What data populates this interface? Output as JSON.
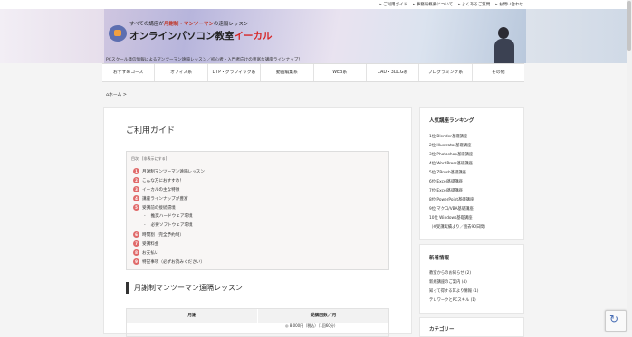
{
  "top_links": [
    "ご利用ガイド",
    "事務局概要について",
    "よくあるご質問",
    "お問い合わせ"
  ],
  "banner": {
    "tagline_pre": "すべての講座が",
    "tagline_highlight": "月謝制・マンツーマン",
    "tagline_post": "の遠隔レッスン",
    "brand_pre": "オンラインパソコン教室",
    "brand_accent": "イーカル",
    "subline": "PCスクール発信情報によるマンツーマン遠隔レッスン／初心者・入門者向けの豊富な講座ラインナップ！"
  },
  "nav": [
    "おすすめコース",
    "オフィス系",
    "DTP・グラフィック系",
    "動画編集系",
    "WEB系",
    "CAD・3DCG系",
    "プログラミング系",
    "その他"
  ],
  "breadcrumb": "ホーム",
  "page_title": "ご利用ガイド",
  "toc": {
    "header": "目次　[非表示にする]",
    "items": [
      {
        "n": "1",
        "label": "月謝制マンツーマン遠隔レッスン"
      },
      {
        "n": "2",
        "label": "こんな方におすすめ！"
      },
      {
        "n": "3",
        "label": "イーカルの主な特徴"
      },
      {
        "n": "4",
        "label": "講座ラインナップが豊富"
      },
      {
        "n": "5",
        "label": "受講前の接続環境"
      },
      {
        "n": "",
        "label": "推奨ハードウェア環境"
      },
      {
        "n": "",
        "label": "必要ソフトウェア環境"
      },
      {
        "n": "6",
        "label": "時間割（完全予約制）"
      },
      {
        "n": "7",
        "label": "受講料金"
      },
      {
        "n": "8",
        "label": "お支払い"
      },
      {
        "n": "9",
        "label": "特記事項（必ずお読みください）"
      }
    ]
  },
  "section_title": "月謝制マンツーマン遠隔レッスン",
  "table": {
    "headers": [
      "月謝",
      "受講回数／月"
    ],
    "cell": "◎ 8,000円（税込）（1回60分）"
  },
  "sidebar": {
    "ranking_title": "人気講座ランキング",
    "ranking": [
      "1位 Blender基礎講座",
      "2位 Illustrator基礎講座",
      "3位 Photoshop基礎講座",
      "4位 WordPress基礎講座",
      "5位 ZBrush基礎講座",
      "6位 Excel基礎講座",
      "7位 Excel基礎講座",
      "8位 PowerPoint基礎講座",
      "9位 マクロ/VBA基礎講座",
      "10位 Windows基礎講座",
      "（※受講実績より／過去90日間）"
    ],
    "news_title": "新着情報",
    "news": [
      "教室からのお知らせ (2)",
      "新規講座のご案内 (4)",
      "知って得する耳より情報 (1)",
      "テレワークとPCスキル (1)"
    ],
    "next_title": "カテゴリー"
  }
}
